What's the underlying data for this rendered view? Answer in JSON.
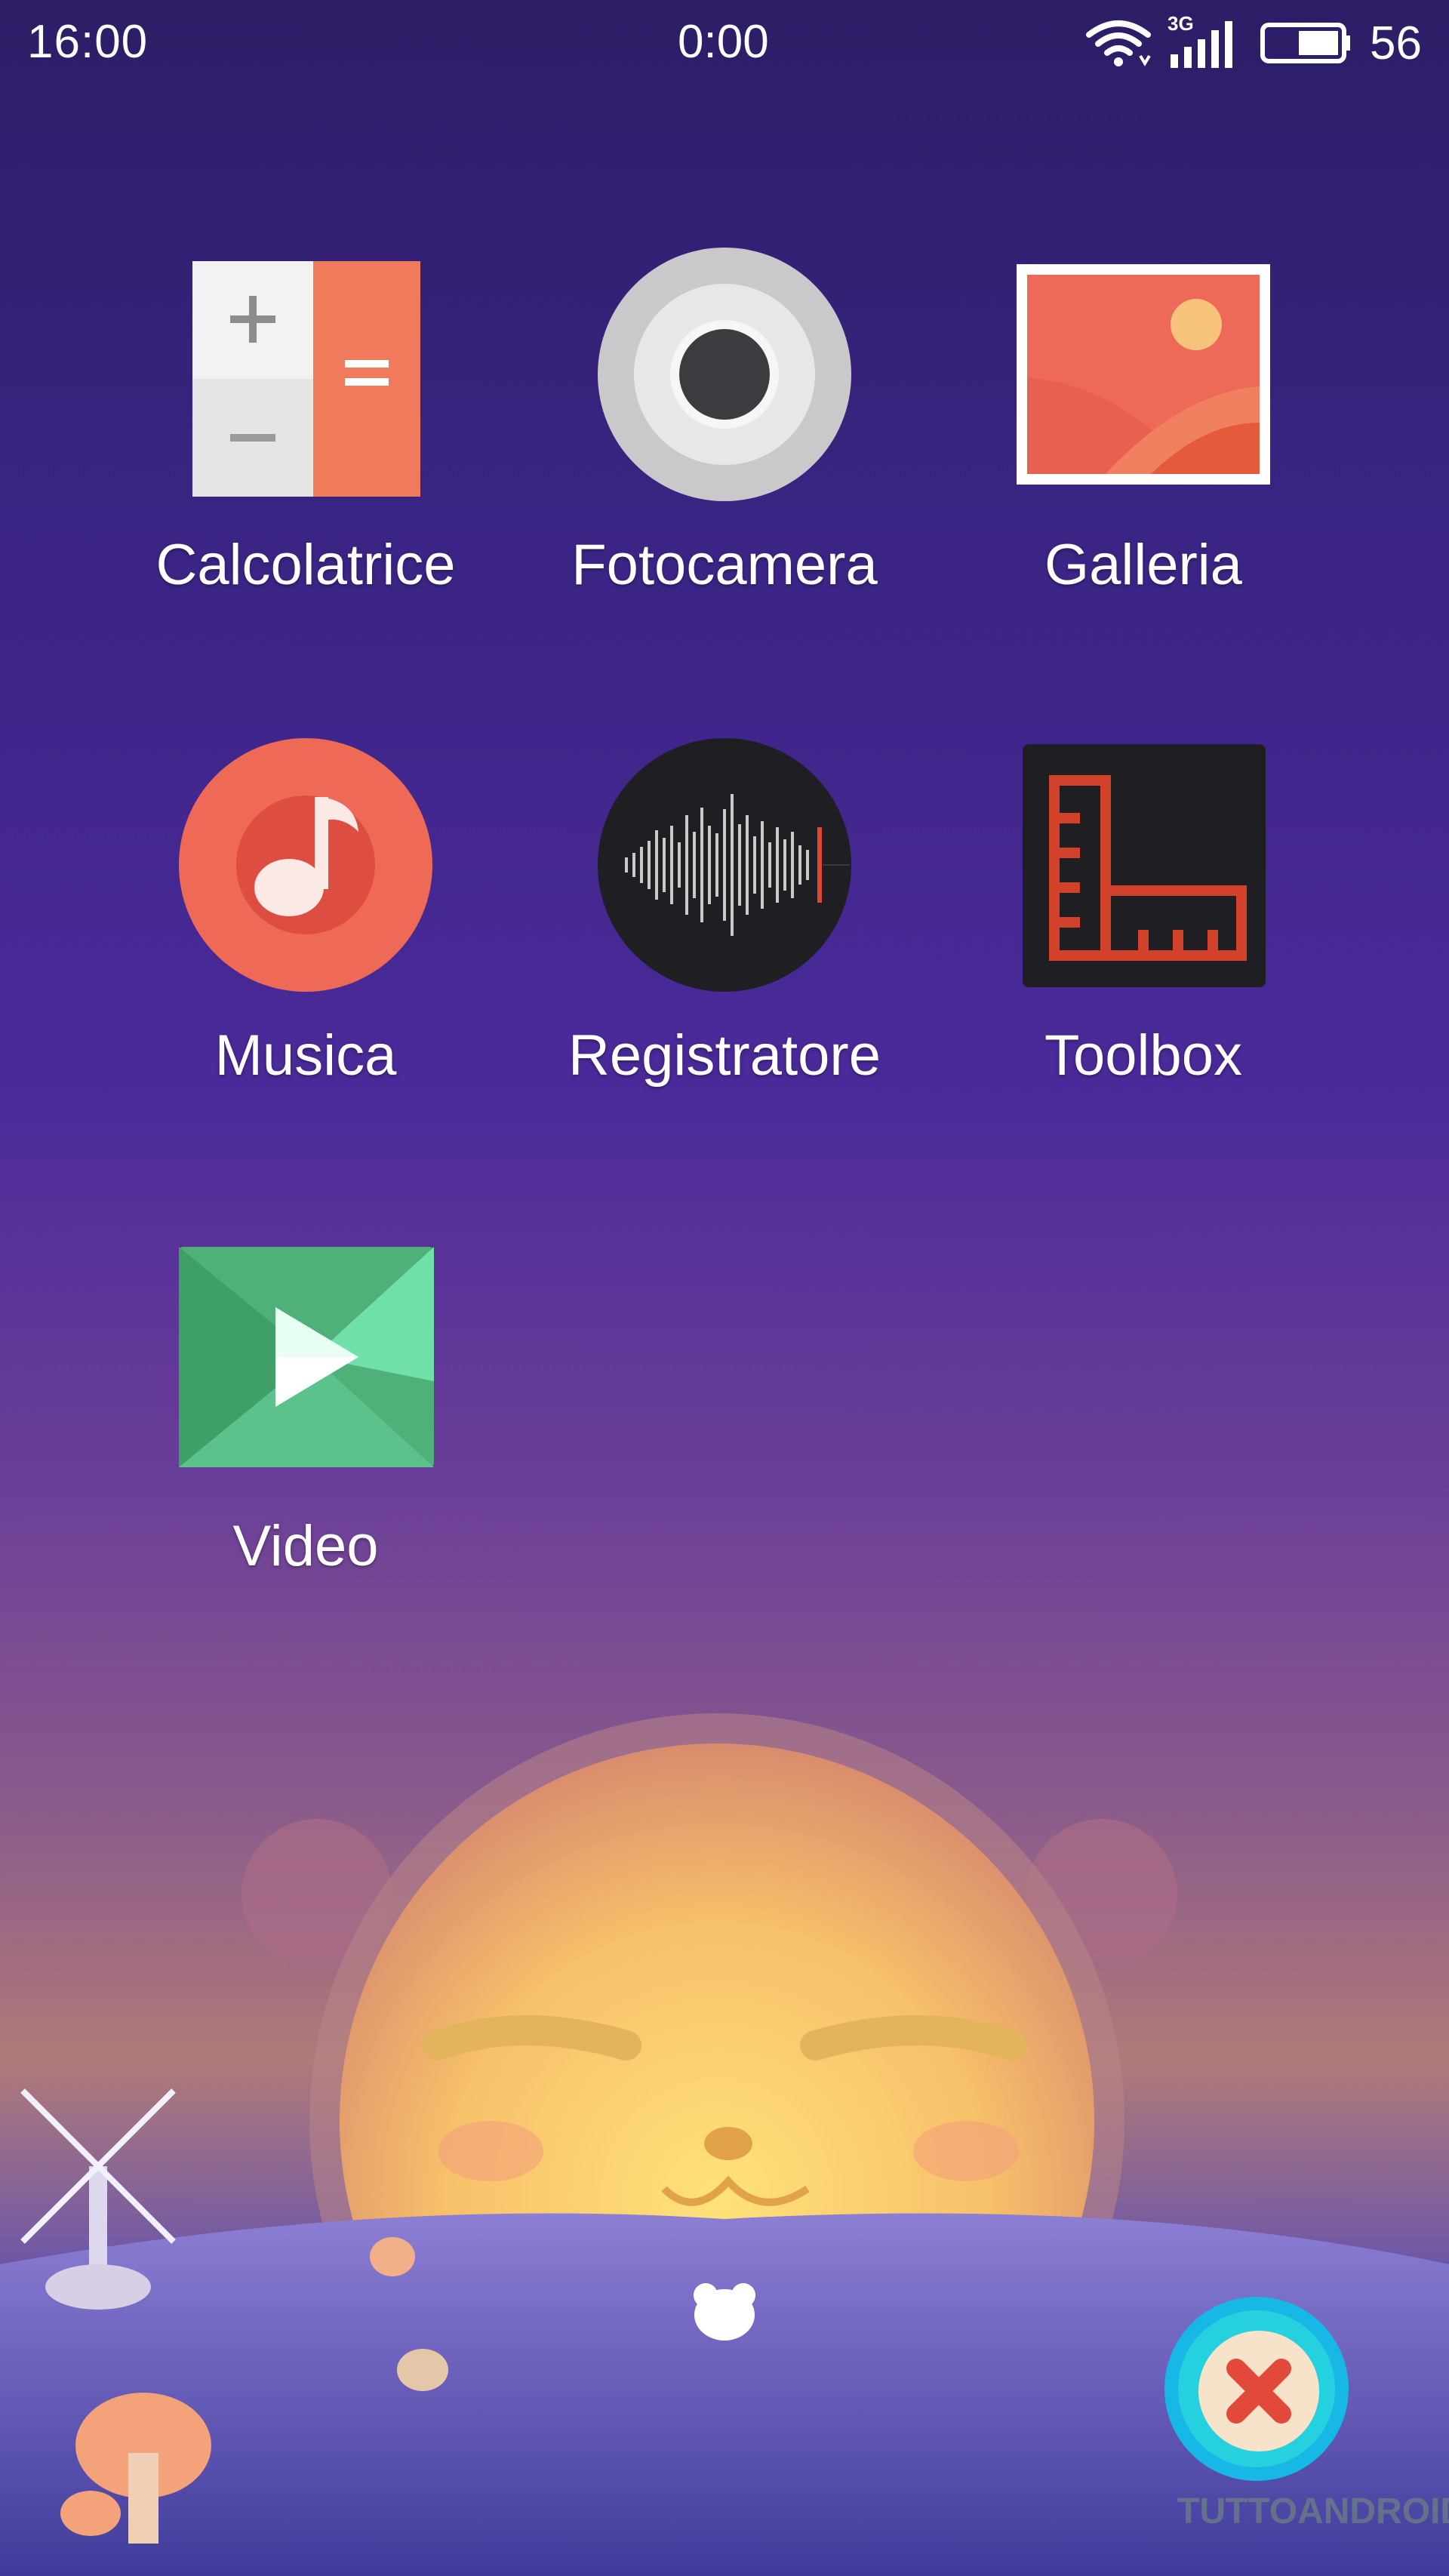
{
  "status_bar": {
    "time": "16:00",
    "center_clock": "0:00",
    "network": "3G",
    "battery_level": "56",
    "icons": [
      "wifi-icon",
      "signal-icon",
      "battery-icon"
    ]
  },
  "apps": [
    {
      "label": "Calcolatrice",
      "icon": "calculator-icon"
    },
    {
      "label": "Fotocamera",
      "icon": "camera-icon"
    },
    {
      "label": "Galleria",
      "icon": "gallery-icon"
    },
    {
      "label": "Musica",
      "icon": "music-icon"
    },
    {
      "label": "Registratore",
      "icon": "recorder-icon"
    },
    {
      "label": "Toolbox",
      "icon": "toolbox-icon"
    },
    {
      "label": "Video",
      "icon": "video-icon"
    }
  ],
  "bottom": {
    "handle_icon": "bear-handle-icon",
    "fab_icon": "close-icon"
  },
  "watermark": "TUTTOANDROID",
  "colors": {
    "accent_red": "#f0684f",
    "dark": "#1f1d22"
  }
}
